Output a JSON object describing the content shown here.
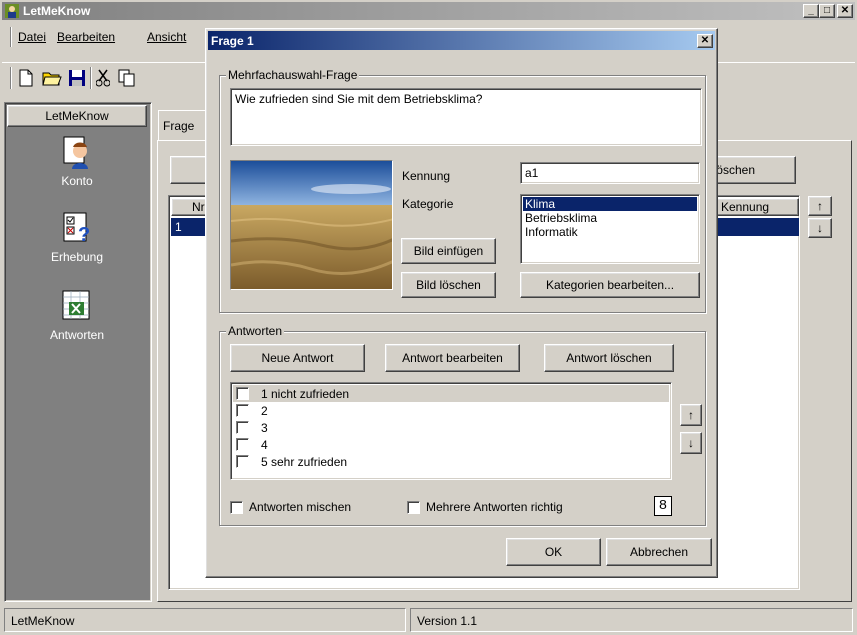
{
  "main_window": {
    "title": "LetMeKnow",
    "menu": [
      "Datei",
      "Bearbeiten",
      "Ansicht"
    ],
    "sidebar": {
      "header": "LetMeKnow",
      "items": [
        {
          "label": "Konto",
          "icon": "person-icon"
        },
        {
          "label": "Erhebung",
          "icon": "survey-icon"
        },
        {
          "label": "Antworten",
          "icon": "spreadsheet-icon"
        }
      ]
    },
    "tab_label": "Frage",
    "delete_button_partial": "öschen",
    "table": {
      "col_nr_partial": "Nr",
      "col_kennung": "Kennung",
      "row_nr": "1"
    },
    "status": {
      "left": "LetMeKnow",
      "right": "Version 1.1"
    }
  },
  "dialog": {
    "title": "Frage 1",
    "question_group": "Mehrfachauswahl-Frage",
    "question_text": "Wie zufrieden sind Sie mit dem Betriebsklima?",
    "kennung_label": "Kennung",
    "kennung_value": "a1",
    "kategorie_label": "Kategorie",
    "categories": [
      "Klima",
      "Betriebsklima",
      "Informatik"
    ],
    "selected_category": "Klima",
    "btn_bild_einfuegen": "Bild einfügen",
    "btn_bild_loeschen": "Bild löschen",
    "btn_kategorien": "Kategorien bearbeiten...",
    "answers_group": "Antworten",
    "btn_neue_antwort": "Neue Antwort",
    "btn_antwort_bearbeiten": "Antwort bearbeiten",
    "btn_antwort_loeschen": "Antwort löschen",
    "answers": [
      "1 nicht zufrieden",
      "2",
      "3",
      "4",
      "5 sehr zufrieden"
    ],
    "chk_mischen": "Antworten mischen",
    "chk_mehrere": "Mehrere Antworten richtig",
    "count_value": "8",
    "btn_ok": "OK",
    "btn_abbrechen": "Abbrechen"
  },
  "colors": {
    "titlebar_active": "#0a246a",
    "titlebar_inactive": "#808080",
    "selection": "#0a246a",
    "face": "#d4d0c8",
    "sidebar": "#808080"
  }
}
